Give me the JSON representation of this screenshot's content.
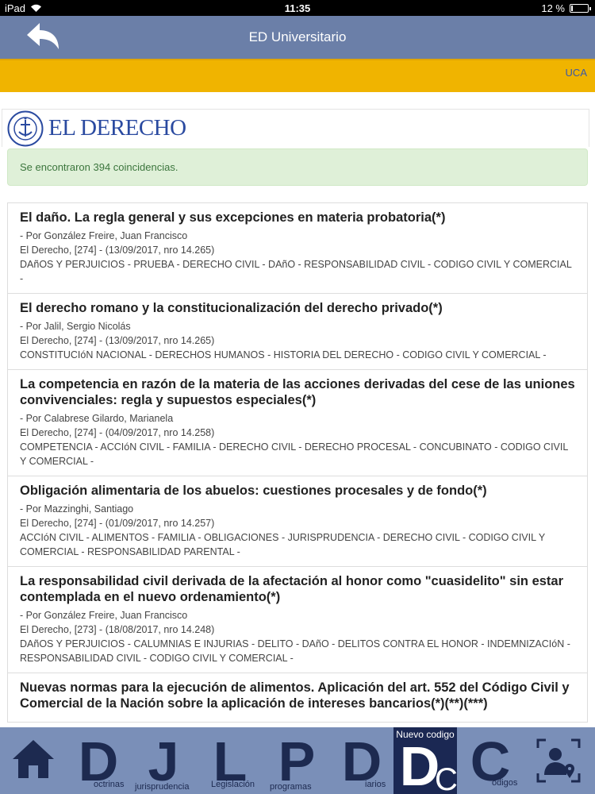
{
  "status": {
    "device": "iPad",
    "time": "11:35",
    "battery_text": "12 %",
    "battery_level": 0.12
  },
  "nav": {
    "title": "ED Universitario"
  },
  "banner": {
    "label": "UCA"
  },
  "logo": {
    "text": "EL DERECHO"
  },
  "alert": {
    "text": "Se encontraron 394 coincidencias."
  },
  "results": [
    {
      "title": "El daño. La regla general y sus excepciones en materia probatoria(*)",
      "author": "- Por González Freire, Juan Francisco",
      "ref": "El Derecho, [274] - (13/09/2017, nro 14.265)",
      "tags": "DAñOS Y PERJUICIOS - PRUEBA - DERECHO CIVIL - DAñO - RESPONSABILIDAD CIVIL - CODIGO CIVIL Y COMERCIAL -"
    },
    {
      "title": "El derecho romano y la constitucionalización del derecho privado(*)",
      "author": "- Por Jalil, Sergio Nicolás",
      "ref": "El Derecho, [274] - (13/09/2017, nro 14.265)",
      "tags": "CONSTITUCIóN NACIONAL - DERECHOS HUMANOS - HISTORIA DEL DERECHO - CODIGO CIVIL Y COMERCIAL -"
    },
    {
      "title": "La competencia en razón de la materia de las acciones derivadas del cese de las uniones convivenciales: regla y supuestos especiales(*)",
      "author": "- Por Calabrese Gilardo, Marianela",
      "ref": "El Derecho, [274] - (04/09/2017, nro 14.258)",
      "tags": "COMPETENCIA - ACCIóN CIVIL - FAMILIA - DERECHO CIVIL - DERECHO PROCESAL - CONCUBINATO - CODIGO CIVIL Y COMERCIAL -"
    },
    {
      "title": "Obligación alimentaria de los abuelos: cuestiones procesales y de fondo(*)",
      "author": "- Por Mazzinghi, Santiago",
      "ref": "El Derecho, [274] - (01/09/2017, nro 14.257)",
      "tags": "ACCIóN CIVIL - ALIMENTOS - FAMILIA - OBLIGACIONES - JURISPRUDENCIA - DERECHO CIVIL - CODIGO CIVIL Y COMERCIAL - RESPONSABILIDAD PARENTAL -"
    },
    {
      "title": "La responsabilidad civil derivada de la afectación al honor como \"cuasidelito\" sin estar contemplada en el nuevo ordenamiento(*)",
      "author": "- Por González Freire, Juan Francisco",
      "ref": "El Derecho, [273] - (18/08/2017, nro 14.248)",
      "tags": "DAñOS Y PERJUICIOS - CALUMNIAS E INJURIAS - DELITO - DAñO - DELITOS CONTRA EL HONOR - INDEMNIZACIóN - RESPONSABILIDAD CIVIL - CODIGO CIVIL Y COMERCIAL -"
    },
    {
      "title": "Nuevas normas para la ejecución de alimentos. Aplicación del art. 552 del Código Civil y Comercial de la Nación sobre la aplicación de intereses bancarios(*)(**)(***)",
      "author": "",
      "ref": "",
      "tags": ""
    }
  ],
  "tabbar": {
    "tabs": [
      {
        "letter": "D",
        "label": "octrinas"
      },
      {
        "letter": "J",
        "label": "jurisprudencia"
      },
      {
        "letter": "L",
        "label": "Legislación"
      },
      {
        "letter": "P",
        "label": "programas"
      },
      {
        "letter": "D",
        "label": "iarios"
      },
      {
        "letter": "D",
        "sub": "C",
        "label": "Nuevo codigo"
      },
      {
        "letter": "C",
        "label": "ódigos"
      }
    ]
  }
}
